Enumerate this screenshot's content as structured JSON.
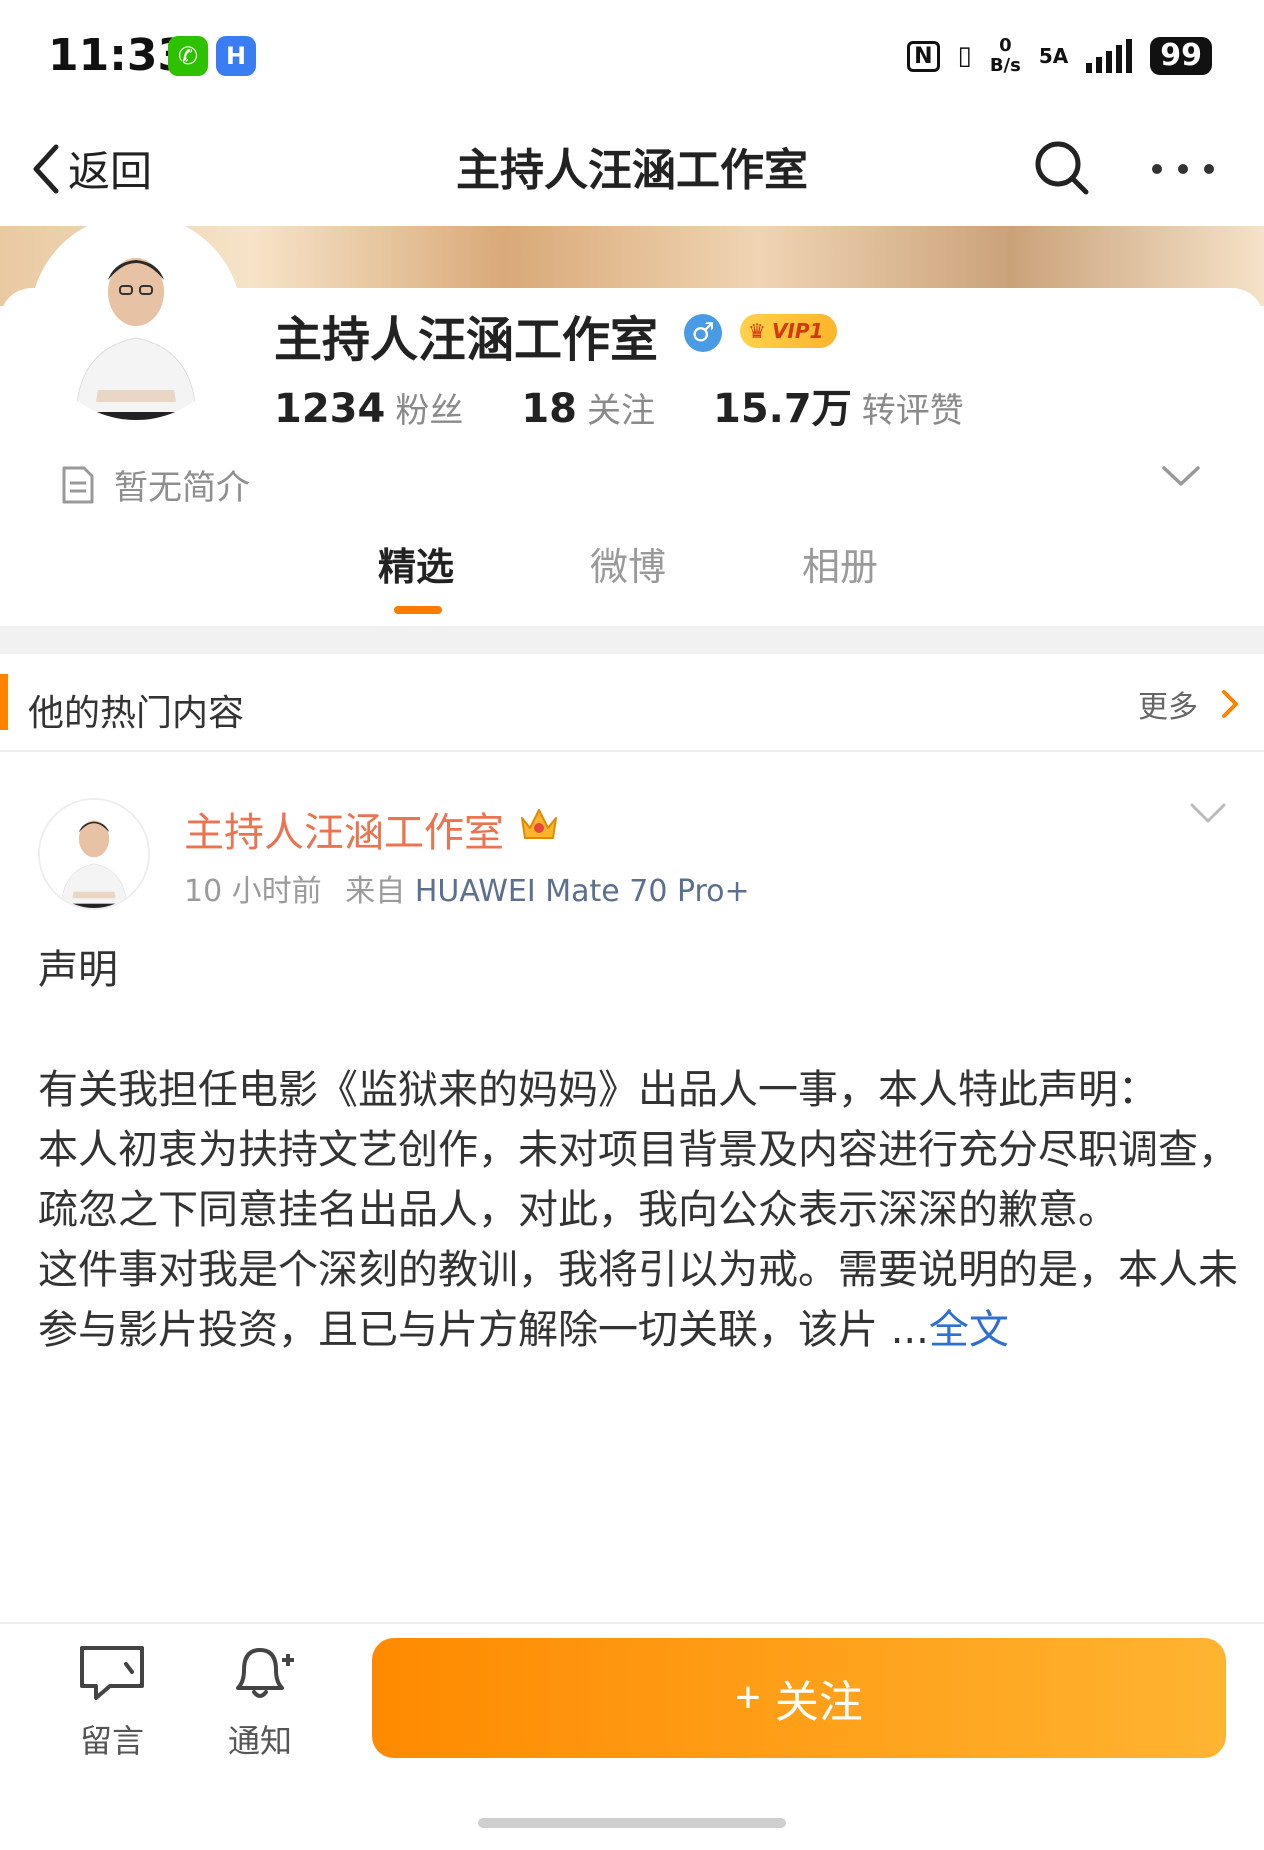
{
  "status_bar": {
    "time": "11:33",
    "net_speed_top": "0",
    "net_speed_unit": "B/s",
    "net_type": "5A",
    "battery": "99",
    "icons": [
      "wechat-icon",
      "app-icon",
      "nfc-icon",
      "signal-icon",
      "battery-icon"
    ]
  },
  "nav": {
    "back_label": "返回",
    "title": "主持人汪涵工作室"
  },
  "profile": {
    "name": "主持人汪涵工作室",
    "vip_label": "VIP1",
    "stats": [
      {
        "value": "1234",
        "label": "粉丝"
      },
      {
        "value": "18",
        "label": "关注"
      },
      {
        "value": "15.7万",
        "label": "转评赞"
      }
    ],
    "intro": "暂无简介"
  },
  "tabs": [
    {
      "label": "精选",
      "active": true
    },
    {
      "label": "微博",
      "active": false
    },
    {
      "label": "相册",
      "active": false
    }
  ],
  "section": {
    "title": "他的热门内容",
    "more_label": "更多"
  },
  "post": {
    "author": "主持人汪涵工作室",
    "time": "10 小时前",
    "source_prefix": "来自",
    "device": "HUAWEI Mate 70 Pro+",
    "paragraphs": [
      "声明",
      "有关我担任电影《监狱来的妈妈》出品人一事，本人特此声明：",
      "本人初衷为扶持文艺创作，未对项目背景及内容进行充分尽职调查，疏忽之下同意挂名出品人，对此，我向公众表示深深的歉意。",
      "这件事对我是个深刻的教训，我将引以为戒。需要说明的是，本人未参与影片投资，且已与片方解除一切关联，该片 ..."
    ],
    "full_text_label": "全文"
  },
  "bottom_bar": {
    "message_label": "留言",
    "notify_label": "通知",
    "follow_label": "关注",
    "follow_plus": "+"
  },
  "colors": {
    "accent_orange": "#ff8200",
    "author_color": "#eb7350",
    "link_blue": "#2e6fd1"
  }
}
